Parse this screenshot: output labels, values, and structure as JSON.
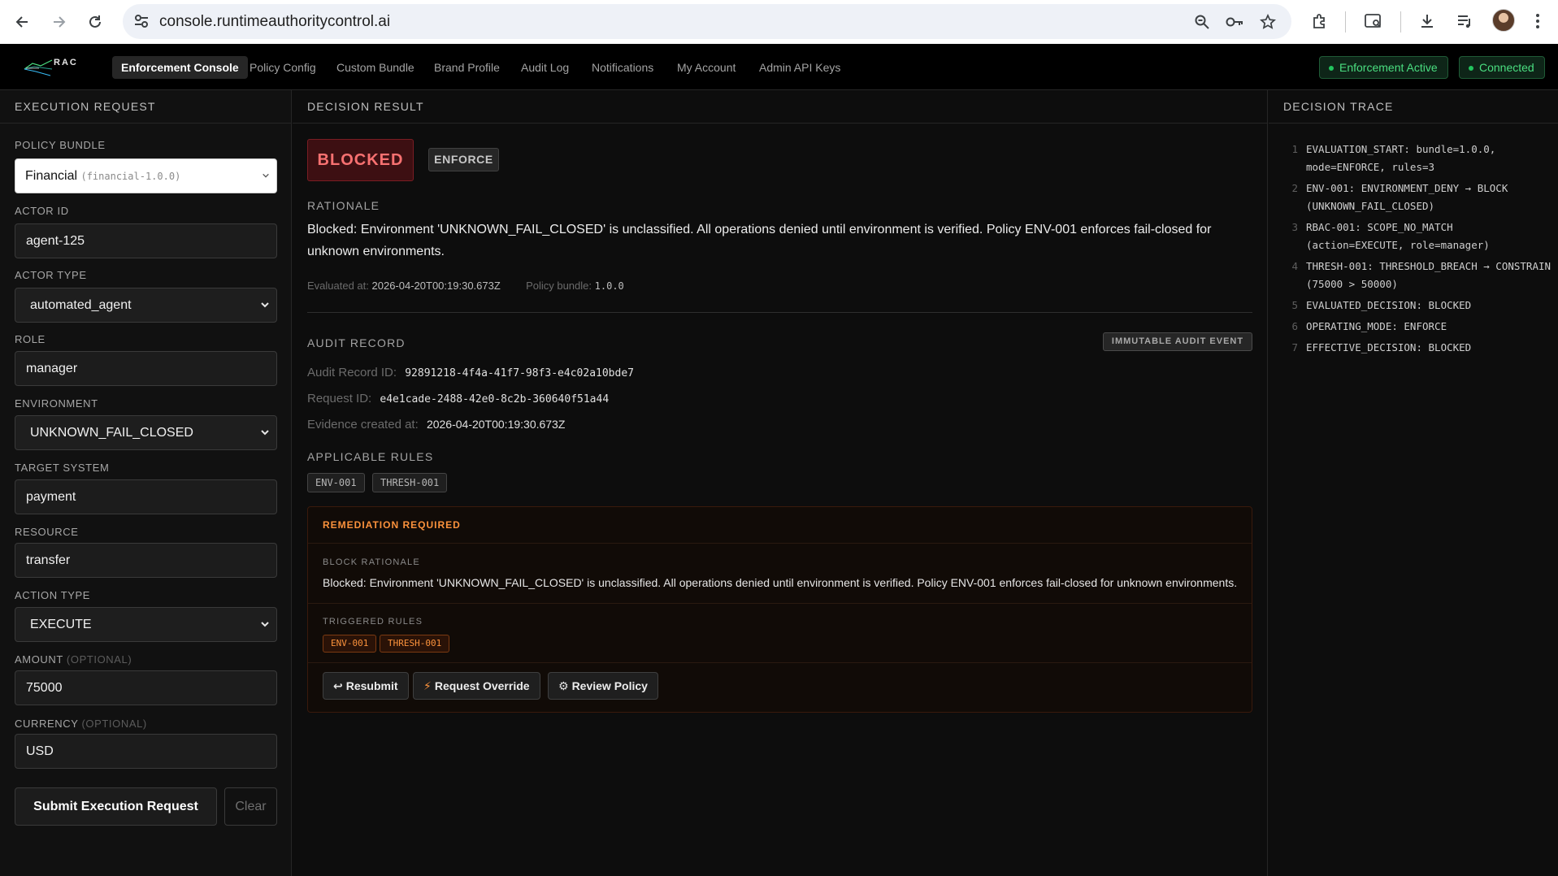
{
  "browser": {
    "url": "console.runtimeauthoritycontrol.ai"
  },
  "header": {
    "logo_text": "RAC",
    "nav": [
      {
        "label": "Enforcement Console",
        "active": true
      },
      {
        "label": "Policy Config"
      },
      {
        "label": "Custom Bundle"
      },
      {
        "label": "Brand Profile"
      },
      {
        "label": "Audit Log"
      },
      {
        "label": "Notifications"
      },
      {
        "label": "My Account"
      },
      {
        "label": "Admin API Keys"
      }
    ],
    "status": {
      "enforcement": "Enforcement Active",
      "connection": "Connected"
    }
  },
  "request": {
    "title": "EXECUTION REQUEST",
    "policy_bundle": {
      "label": "POLICY BUNDLE",
      "value": "Financial",
      "id": "(financial-1.0.0)"
    },
    "actor_id": {
      "label": "ACTOR ID",
      "value": "agent-125"
    },
    "actor_type": {
      "label": "ACTOR TYPE",
      "value": "automated_agent"
    },
    "role": {
      "label": "ROLE",
      "value": "manager"
    },
    "environment": {
      "label": "ENVIRONMENT",
      "value": "UNKNOWN_FAIL_CLOSED"
    },
    "target_system": {
      "label": "TARGET SYSTEM",
      "value": "payment"
    },
    "resource": {
      "label": "RESOURCE",
      "value": "transfer"
    },
    "action_type": {
      "label": "ACTION TYPE",
      "value": "EXECUTE"
    },
    "amount": {
      "label": "AMOUNT",
      "optional": "(OPTIONAL)",
      "value": "75000"
    },
    "currency": {
      "label": "CURRENCY",
      "optional": "(OPTIONAL)",
      "value": "USD"
    },
    "submit_label": "Submit Execution Request",
    "clear_label": "Clear"
  },
  "result": {
    "title": "DECISION RESULT",
    "decision": "BLOCKED",
    "mode": "ENFORCE",
    "rationale_label": "RATIONALE",
    "rationale": "Blocked: Environment 'UNKNOWN_FAIL_CLOSED' is unclassified. All operations denied until environment is verified. Policy ENV-001 enforces fail-closed for unknown environments.",
    "evaluated_label": "Evaluated at:",
    "evaluated_at": "2026-04-20T00:19:30.673Z",
    "bundle_label": "Policy bundle:",
    "bundle_version": "1.0.0",
    "audit": {
      "title": "AUDIT RECORD",
      "badge": "IMMUTABLE AUDIT EVENT",
      "record_label": "Audit Record ID:",
      "record_id": "92891218-4f4a-41f7-98f3-e4c02a10bde7",
      "request_label": "Request ID:",
      "request_id": "e4e1cade-2488-42e0-8c2b-360640f51a44",
      "evidence_label": "Evidence created at:",
      "evidence_at": "2026-04-20T00:19:30.673Z"
    },
    "applicable_rules_label": "APPLICABLE RULES",
    "applicable_rules": [
      "ENV-001",
      "THRESH-001"
    ],
    "remediation": {
      "title": "REMEDIATION REQUIRED",
      "block_label": "BLOCK RATIONALE",
      "block_text": "Blocked: Environment 'UNKNOWN_FAIL_CLOSED' is unclassified. All operations denied until environment is verified. Policy ENV-001 enforces fail-closed for unknown environments.",
      "triggered_label": "TRIGGERED RULES",
      "triggered_rules": [
        "ENV-001",
        "THRESH-001"
      ],
      "actions": {
        "resubmit": "Resubmit",
        "override": "Request Override",
        "review": "Review Policy"
      }
    }
  },
  "trace": {
    "title": "DECISION TRACE",
    "items": [
      {
        "n": "1",
        "text": "EVALUATION_START: bundle=1.0.0, mode=ENFORCE, rules=3"
      },
      {
        "n": "2",
        "text": "ENV-001: ENVIRONMENT_DENY → BLOCK (UNKNOWN_FAIL_CLOSED)"
      },
      {
        "n": "3",
        "text": "RBAC-001: SCOPE_NO_MATCH (action=EXECUTE, role=manager)"
      },
      {
        "n": "4",
        "text": "THRESH-001: THRESHOLD_BREACH → CONSTRAIN (75000 > 50000)"
      },
      {
        "n": "5",
        "text": "EVALUATED_DECISION: BLOCKED"
      },
      {
        "n": "6",
        "text": "OPERATING_MODE: ENFORCE"
      },
      {
        "n": "7",
        "text": "EFFECTIVE_DECISION: BLOCKED"
      }
    ]
  }
}
